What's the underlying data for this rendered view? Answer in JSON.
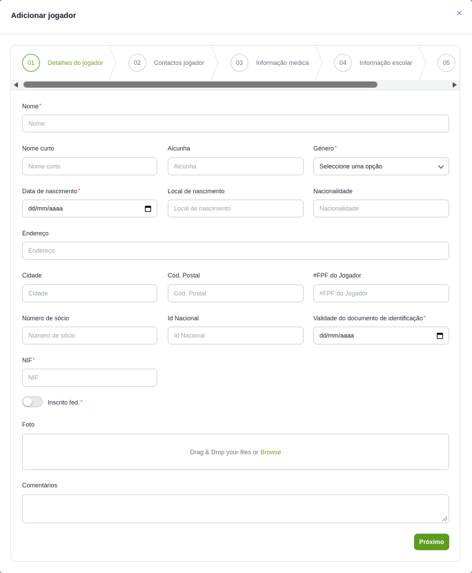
{
  "modal": {
    "title": "Adicionar jogador",
    "close_icon": "×"
  },
  "steps": [
    {
      "num": "01",
      "label": "Detalhes do jogador",
      "active": true
    },
    {
      "num": "02",
      "label": "Contactos jogador"
    },
    {
      "num": "03",
      "label": "Informação medica"
    },
    {
      "num": "04",
      "label": "Informação escolar"
    },
    {
      "num": "05",
      "label": ""
    }
  ],
  "form": {
    "nome": {
      "label": "Nome",
      "required": "*",
      "placeholder": "Nome"
    },
    "nome_curto": {
      "label": "Nome curto",
      "placeholder": "Nome curto"
    },
    "alcunha": {
      "label": "Alcunha",
      "placeholder": "Alcunha"
    },
    "genero": {
      "label": "Género",
      "required": "*",
      "value": "Seleccione uma opção"
    },
    "data_nascimento": {
      "label": "Data de nascimento",
      "required": "*",
      "value": "dd/mm/aaaa"
    },
    "local_nascimento": {
      "label": "Local de nascimento",
      "placeholder": "Local de nascimento"
    },
    "nacionalidade": {
      "label": "Nacionalidade",
      "placeholder": "Nacionalidade"
    },
    "endereco": {
      "label": "Endereço",
      "placeholder": "Endereço"
    },
    "cidade": {
      "label": "Cidade",
      "placeholder": "Cidade"
    },
    "cod_postal": {
      "label": "Cód. Postal",
      "placeholder": "Cód. Postal"
    },
    "fpf": {
      "label": "#FPF do Jogador",
      "placeholder": "#FPF do Jogador"
    },
    "numero_socio": {
      "label": "Número de sócio",
      "placeholder": "Número de sócio"
    },
    "id_nacional": {
      "label": "Id Nacional",
      "placeholder": "Id Nacional"
    },
    "validade_doc": {
      "label": "Validade do documento de identificação",
      "required": "*",
      "value": "dd/mm/aaaa"
    },
    "nif": {
      "label": "NIF",
      "required": "*",
      "placeholder": "NIF"
    },
    "inscrito": {
      "label": "Inscrito fed.",
      "required": "*"
    },
    "foto": {
      "label": "Foto",
      "drop_text": "Drag & Drop your files or",
      "browse": "Browse"
    },
    "comentarios": {
      "label": "Comentários"
    }
  },
  "buttons": {
    "next": "Próximo"
  },
  "colors": {
    "accent": "#6aa62a",
    "button": "#5e9c1f",
    "required": "#ef4444"
  }
}
